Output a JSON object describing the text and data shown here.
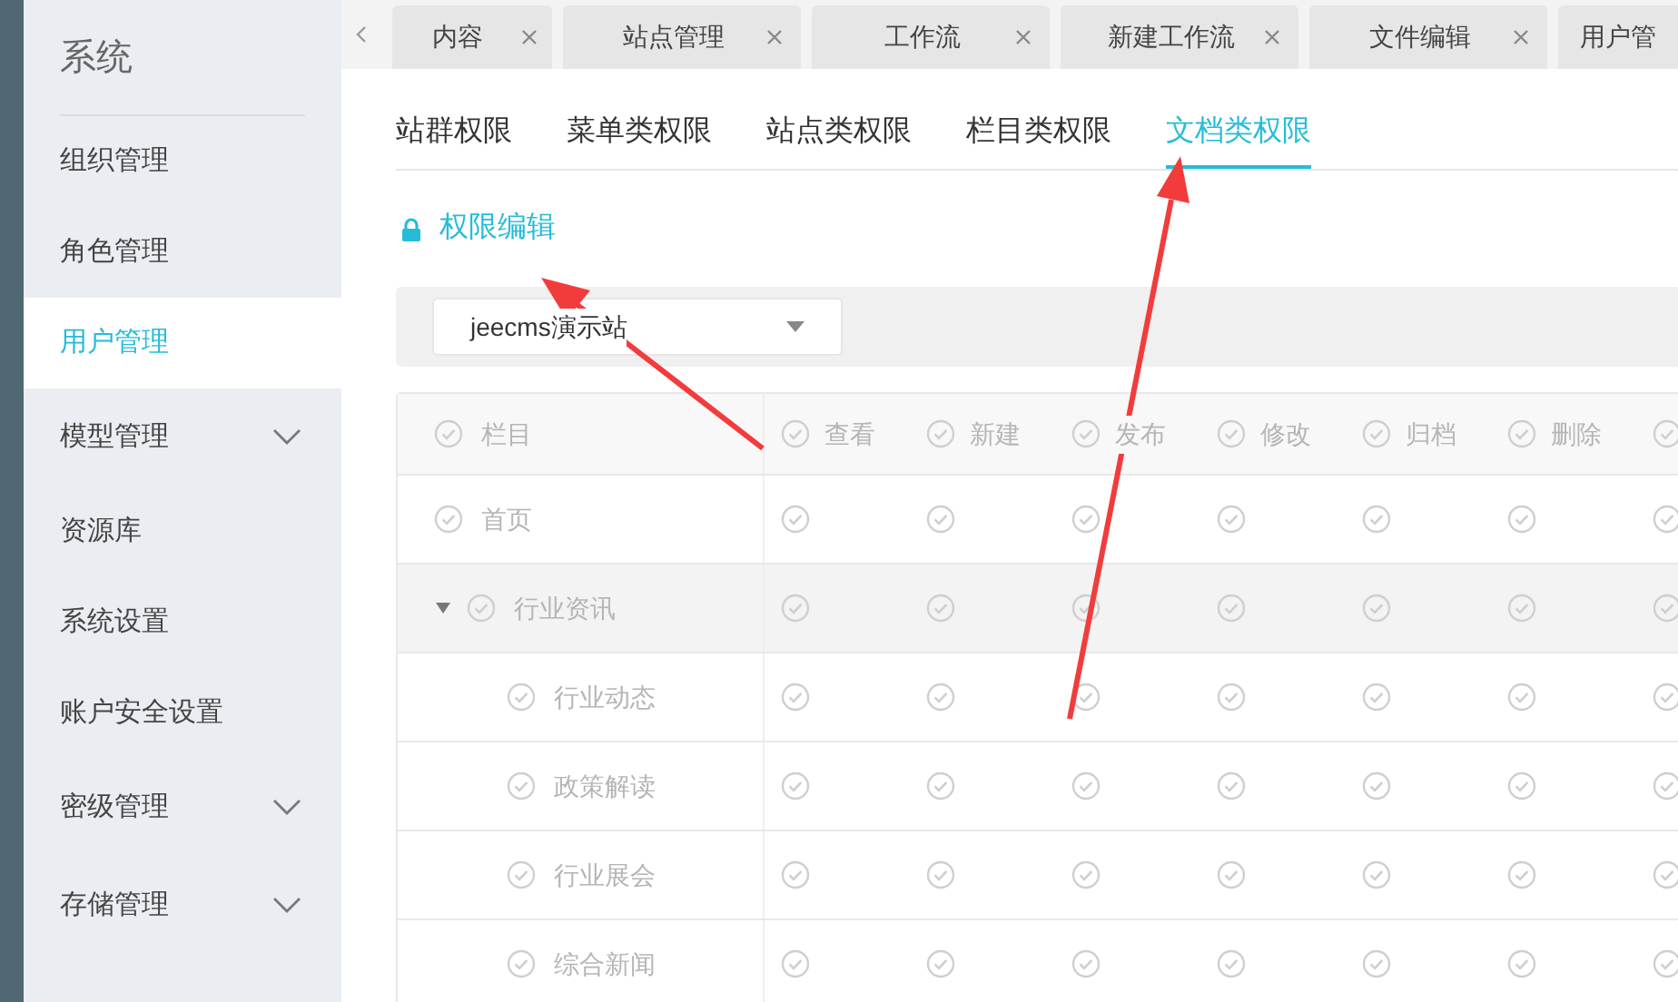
{
  "sidebar": {
    "title": "系统",
    "items": [
      {
        "label": "组织管理",
        "selected": false,
        "expandable": false
      },
      {
        "label": "角色管理",
        "selected": false,
        "expandable": false
      },
      {
        "label": "用户管理",
        "selected": true,
        "expandable": false
      },
      {
        "label": "模型管理",
        "selected": false,
        "expandable": true
      },
      {
        "label": "资源库",
        "selected": false,
        "expandable": false
      },
      {
        "label": "系统设置",
        "selected": false,
        "expandable": false
      },
      {
        "label": "账户安全设置",
        "selected": false,
        "expandable": false
      },
      {
        "label": "密级管理",
        "selected": false,
        "expandable": true
      },
      {
        "label": "存储管理",
        "selected": false,
        "expandable": true
      }
    ]
  },
  "page_tabs": [
    {
      "label": "内容"
    },
    {
      "label": "站点管理"
    },
    {
      "label": "工作流"
    },
    {
      "label": "新建工作流"
    },
    {
      "label": "文件编辑"
    },
    {
      "label": "用户管"
    }
  ],
  "permission_tabs": [
    {
      "label": "站群权限",
      "selected": false
    },
    {
      "label": "菜单类权限",
      "selected": false
    },
    {
      "label": "站点类权限",
      "selected": false
    },
    {
      "label": "栏目类权限",
      "selected": false
    },
    {
      "label": "文档类权限",
      "selected": true
    }
  ],
  "edit_link": "权限编辑",
  "site_select": {
    "value": "jeecms演示站"
  },
  "table": {
    "first_column": "栏目",
    "header_checked": false,
    "columns": [
      "查看",
      "新建",
      "发布",
      "修改",
      "归档",
      "删除"
    ],
    "header_checks": [
      false,
      false,
      false,
      false,
      false,
      false,
      false
    ],
    "rows": [
      {
        "label": "首页",
        "checked": false,
        "checks": [
          false,
          false,
          false,
          false,
          false,
          false,
          false
        ]
      },
      {
        "label": "行业资讯",
        "checked": false,
        "expanded": true,
        "checks": [
          false,
          false,
          false,
          false,
          false,
          false,
          false
        ],
        "children": [
          {
            "label": "行业动态",
            "checked": false,
            "checks": [
              false,
              false,
              false,
              false,
              false,
              false,
              false
            ]
          },
          {
            "label": "政策解读",
            "checked": false,
            "checks": [
              false,
              false,
              false,
              false,
              false,
              false,
              false
            ]
          },
          {
            "label": "行业展会",
            "checked": false,
            "checks": [
              false,
              false,
              false,
              false,
              false,
              false,
              false
            ]
          },
          {
            "label": "综合新闻",
            "checked": false,
            "checks": [
              false,
              false,
              false,
              false,
              false,
              false,
              false
            ]
          }
        ]
      }
    ]
  }
}
